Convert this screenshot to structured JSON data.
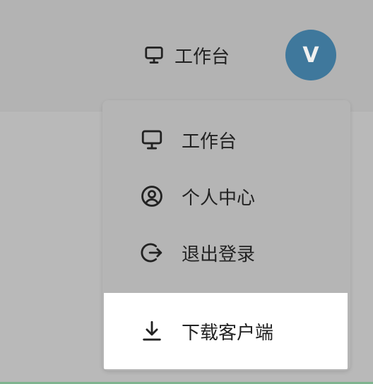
{
  "header": {
    "workbench_label": "工作台",
    "avatar_letter": "V"
  },
  "dropdown": {
    "items": [
      {
        "label": "工作台",
        "icon": "monitor-icon"
      },
      {
        "label": "个人中心",
        "icon": "user-circle-icon"
      },
      {
        "label": "退出登录",
        "icon": "logout-icon"
      },
      {
        "label": "下载客户端",
        "icon": "download-icon"
      }
    ]
  },
  "colors": {
    "avatar_bg": "#3f789c",
    "overlay_bg": "#b9b9b9",
    "active_item_bg": "#ffffff"
  }
}
